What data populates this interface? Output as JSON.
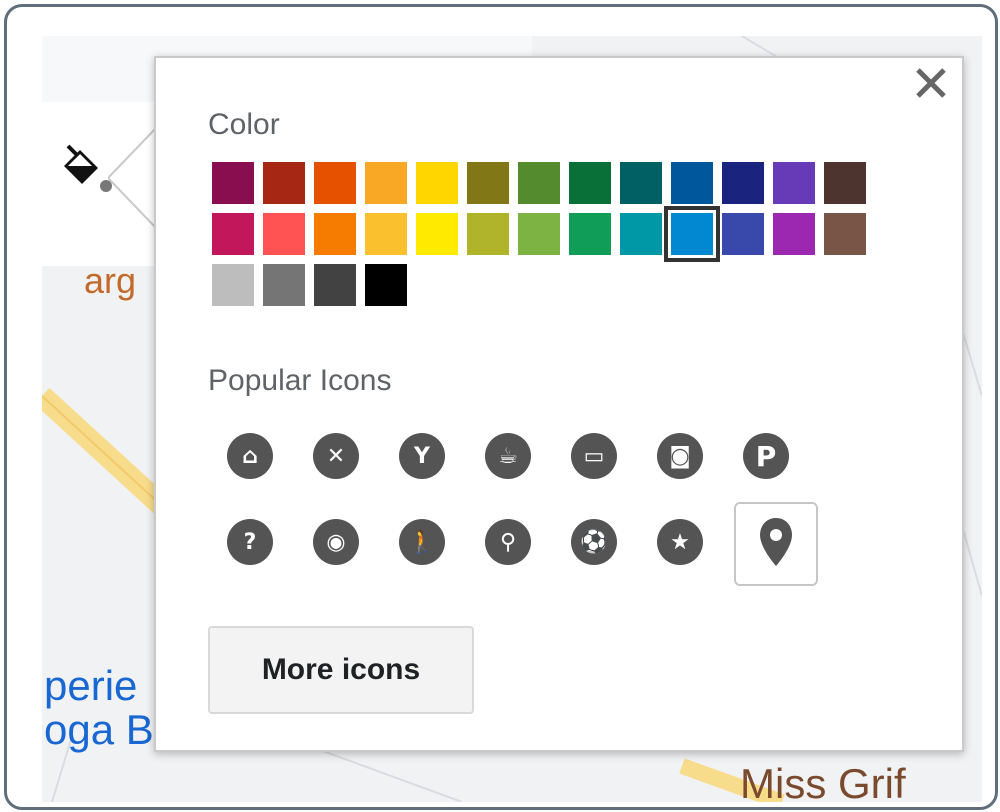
{
  "popup": {
    "color_title": "Color",
    "icons_title": "Popular Icons",
    "more_icons_label": "More icons",
    "close_glyph": "✕"
  },
  "colors": {
    "row1": [
      "#880e4f",
      "#a52714",
      "#e65100",
      "#f9a825",
      "#ffd600",
      "#817717",
      "#558b2f",
      "#097138",
      "#006064",
      "#01579b",
      "#1a237e",
      "#673ab7",
      "#4e342e"
    ],
    "row2": [
      "#c2185b",
      "#ff5252",
      "#f57c00",
      "#fbc02d",
      "#ffea00",
      "#afb42b",
      "#7cb342",
      "#0f9d58",
      "#0097a7",
      "#0288d1",
      "#3949ab",
      "#9c27b0",
      "#795548"
    ],
    "row3": [
      "#bdbdbd",
      "#757575",
      "#424242",
      "#000000"
    ],
    "selected": "#0288d1"
  },
  "icons": {
    "row1": [
      "home-icon",
      "restaurant-icon",
      "bar-icon",
      "cafe-icon",
      "lodging-icon",
      "shopping-icon",
      "parking-icon"
    ],
    "row2": [
      "help-icon",
      "camera-icon",
      "hiking-icon",
      "cycling-icon",
      "soccer-icon",
      "star-icon",
      "place-pin-icon"
    ],
    "selected": "place-pin-icon"
  },
  "map": {
    "label_1": "perie",
    "label_2": "oga B",
    "label_3": "Miss Grif",
    "label_4": "arg"
  }
}
